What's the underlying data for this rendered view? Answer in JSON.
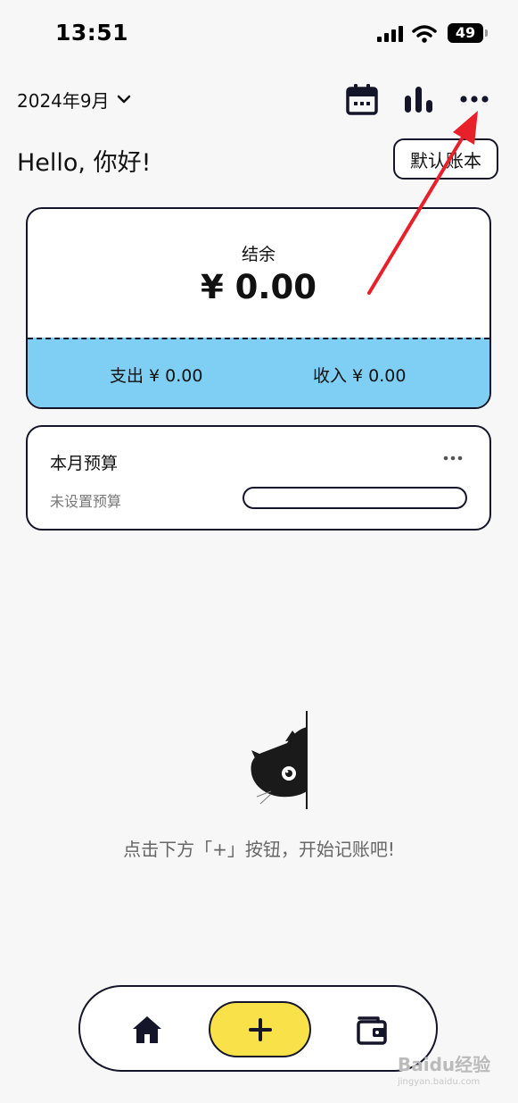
{
  "status_bar": {
    "time": "13:51",
    "battery": "49",
    "icons": [
      "signal-icon",
      "wifi-icon",
      "battery-icon"
    ]
  },
  "header": {
    "month": "2024年9月",
    "icons": [
      "chevron-down-icon",
      "calendar-icon",
      "bar-chart-icon",
      "more-icon"
    ]
  },
  "greeting": "Hello, 你好!",
  "account_book_button": "默认账本",
  "balance_card": {
    "label": "结余",
    "value": "¥ 0.00",
    "expense": "支出 ¥ 0.00",
    "income": "收入 ¥ 0.00"
  },
  "budget_card": {
    "title": "本月预算",
    "status": "未设置预算"
  },
  "empty_state": {
    "hint": "点击下方「+」按钮，开始记账吧!"
  },
  "bottom_nav": {
    "icons": [
      "home-icon",
      "plus-icon",
      "wallet-icon"
    ]
  },
  "watermark": {
    "brand": "Baidu经验",
    "url": "jingyan.baidu.com"
  },
  "colors": {
    "accent_blue": "#7ecff3",
    "accent_yellow": "#f9e14a",
    "outline": "#15152a",
    "annotation_red": "#e8202a"
  }
}
